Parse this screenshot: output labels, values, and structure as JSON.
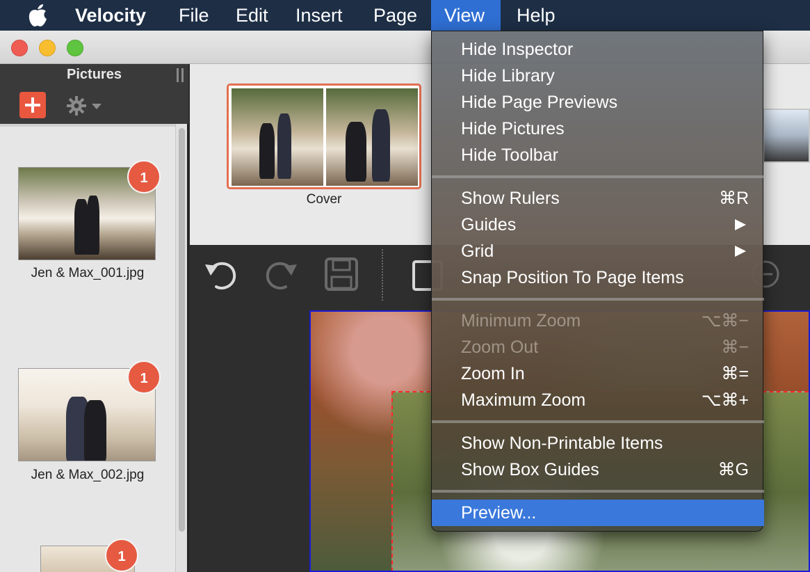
{
  "menubar": {
    "app_name": "Velocity",
    "items": [
      "File",
      "Edit",
      "Insert",
      "Page",
      "View",
      "Help"
    ],
    "active": "View"
  },
  "sidebar": {
    "title": "Pictures",
    "pictures": [
      {
        "filename": "Jen & Max_001.jpg",
        "badge": "1"
      },
      {
        "filename": "Jen & Max_002.jpg",
        "badge": "1"
      },
      {
        "filename": "",
        "badge": "1"
      }
    ]
  },
  "previews": {
    "cover_label": "Cover"
  },
  "view_menu": {
    "items": [
      {
        "label": "Hide Inspector",
        "shortcut": "",
        "enabled": true
      },
      {
        "label": "Hide Library",
        "shortcut": "",
        "enabled": true
      },
      {
        "label": "Hide Page Previews",
        "shortcut": "",
        "enabled": true
      },
      {
        "label": "Hide Pictures",
        "shortcut": "",
        "enabled": true
      },
      {
        "label": "Hide Toolbar",
        "shortcut": "",
        "enabled": true
      },
      {
        "label": "Show Rulers",
        "shortcut": "⌘R",
        "enabled": true
      },
      {
        "label": "Guides",
        "shortcut": "",
        "submenu": true,
        "enabled": true
      },
      {
        "label": "Grid",
        "shortcut": "",
        "submenu": true,
        "enabled": true
      },
      {
        "label": "Snap Position To Page Items",
        "shortcut": "",
        "enabled": true
      },
      {
        "label": "Minimum Zoom",
        "shortcut": "⌥⌘−",
        "enabled": false
      },
      {
        "label": "Zoom Out",
        "shortcut": "⌘−",
        "enabled": false
      },
      {
        "label": "Zoom In",
        "shortcut": "⌘=",
        "enabled": true
      },
      {
        "label": "Maximum Zoom",
        "shortcut": "⌥⌘+",
        "enabled": true
      },
      {
        "label": "Show Non-Printable Items",
        "shortcut": "",
        "enabled": true
      },
      {
        "label": "Show Box Guides",
        "shortcut": "⌘G",
        "enabled": true
      },
      {
        "label": "Preview...",
        "shortcut": "",
        "enabled": true,
        "selected": true
      }
    ]
  },
  "colors": {
    "menubar": "#1d2e45",
    "menu_highlight": "#3a78db",
    "accent": "#e9573f",
    "badge": "#e65a42"
  }
}
